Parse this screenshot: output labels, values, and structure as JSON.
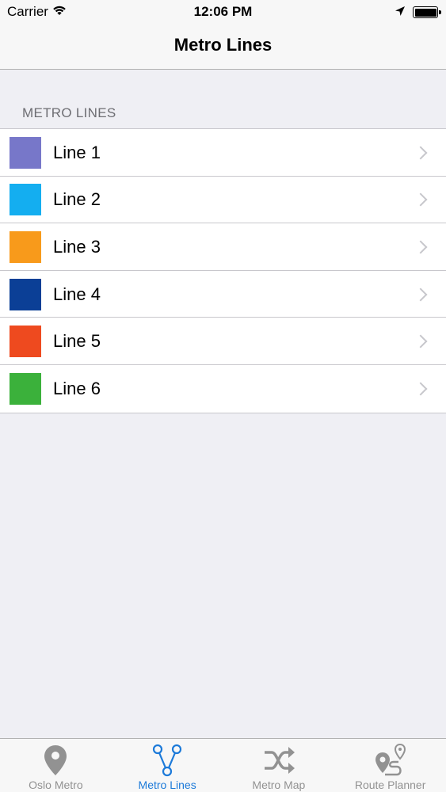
{
  "status_bar": {
    "carrier": "Carrier",
    "time": "12:06 PM"
  },
  "nav": {
    "title": "Metro Lines"
  },
  "section": {
    "header": "METRO LINES"
  },
  "lines": [
    {
      "label": "Line 1",
      "color": "#7777c9"
    },
    {
      "label": "Line 2",
      "color": "#14aef0"
    },
    {
      "label": "Line 3",
      "color": "#f89a1b"
    },
    {
      "label": "Line 4",
      "color": "#0b3f96"
    },
    {
      "label": "Line 5",
      "color": "#ee4a1f"
    },
    {
      "label": "Line 6",
      "color": "#3bb13b"
    }
  ],
  "tabs": [
    {
      "label": "Oslo Metro",
      "icon": "map-pin-icon",
      "active": false
    },
    {
      "label": "Metro Lines",
      "icon": "metro-lines-icon",
      "active": true
    },
    {
      "label": "Metro Map",
      "icon": "shuffle-icon",
      "active": false
    },
    {
      "label": "Route Planner",
      "icon": "route-planner-icon",
      "active": false
    }
  ],
  "colors": {
    "accent": "#1c7ad9",
    "inactive_tab": "#929292"
  }
}
